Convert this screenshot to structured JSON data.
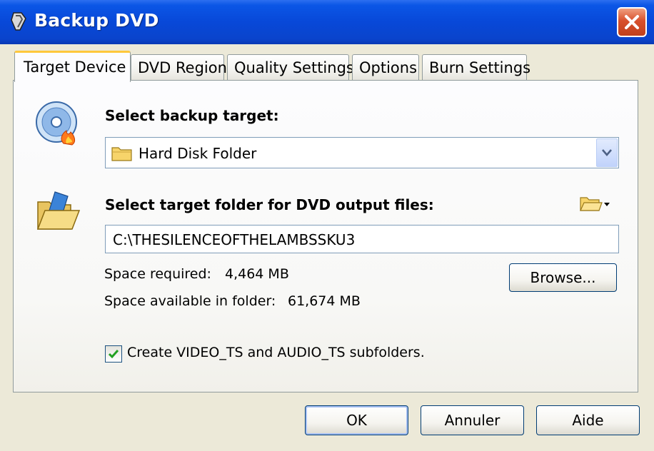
{
  "window": {
    "title": "Backup DVD",
    "close_label": "×"
  },
  "tabs": [
    {
      "label": "Target Device",
      "active": true
    },
    {
      "label": "DVD Region",
      "active": false
    },
    {
      "label": "Quality Settings",
      "active": false
    },
    {
      "label": "Options",
      "active": false
    },
    {
      "label": "Burn Settings",
      "active": false
    }
  ],
  "target": {
    "heading": "Select backup target:",
    "selected": "Hard Disk Folder"
  },
  "folder": {
    "heading": "Select target folder for DVD output files:",
    "path": "C:\\THESILENCEOFTHELAMBSSKU3",
    "space_required_label": "Space required:",
    "space_required_value": "4,464 MB",
    "space_available_label": "Space available in folder:",
    "space_available_value": "61,674 MB",
    "browse_label": "Browse...",
    "subfolders_label": "Create VIDEO_TS and AUDIO_TS subfolders.",
    "subfolders_checked": true
  },
  "buttons": {
    "ok": "OK",
    "cancel": "Annuler",
    "help": "Aide"
  },
  "colors": {
    "titlebar": "#0848d8",
    "active_tab_accent": "#ffc83c",
    "checkmark": "#21a121"
  }
}
